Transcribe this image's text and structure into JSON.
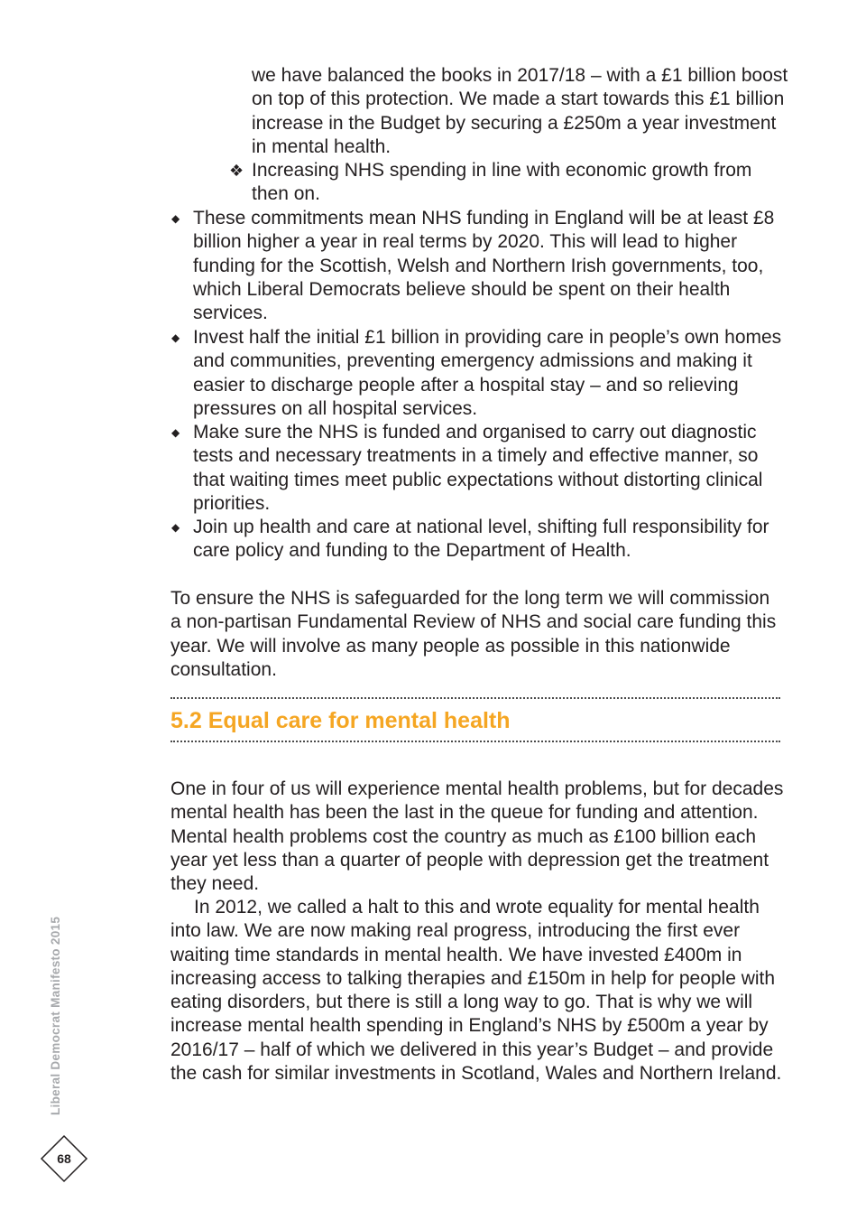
{
  "continuation": {
    "sub_items": [
      "we have balanced the books in 2017/18 – with a £1 billion boost on top of this protection. We made a start towards this £1 billion increase in the Budget by securing a £250m a year investment in mental health.",
      "Increasing NHS spending in line with economic growth from then on."
    ],
    "sub_bullet_glyph": "❖"
  },
  "bullets": {
    "glyph": "◆",
    "items": [
      "These commitments mean NHS funding in England will be at least £8 billion higher a year in real terms by 2020. This will lead to higher funding for the Scottish, Welsh and Northern Irish governments, too, which Liberal Democrats believe should be spent on their health services.",
      "Invest half the initial £1 billion in providing care in people’s own homes and communities, preventing emergency admissions and making it easier to discharge people after a hospital stay – and so relieving pressures on all hospital services.",
      "Make sure the NHS is funded and organised to carry out diagnostic tests and necessary treatments in a timely and effective manner, so that waiting times meet public expectations without distorting clinical priorities.",
      "Join up health and care at national level, shifting full responsibility for care policy and funding to the Department of Health."
    ]
  },
  "review_paragraph": "To ensure the NHS is safeguarded for the long term we will commission a non-partisan Fundamental Review of NHS and social care funding this year. We will involve as many people as possible in this nationwide consultation.",
  "section": {
    "heading": "5.2 Equal care for mental health",
    "heading_color": "#f5a623",
    "paragraphs": [
      "One in four of us will experience mental health problems, but for decades mental health has been the last in the queue for funding and attention. Mental health problems cost the country as much as £100 billion each year yet less than a quarter of people with depression get the treatment they need.",
      "In 2012, we called a halt to this and wrote equality for mental health into law. We are now making real progress, introducing the first ever waiting time standards in mental health. We have invested £400m in increasing access to talking therapies and £150m in help for people with eating disorders, but there is still a long way to go. That is why we will increase mental health spending in England’s NHS by £500m a year by 2016/17 – half of which we delivered in this year’s Budget – and provide the cash for similar investments in Scotland, Wales and Northern Ireland."
    ]
  },
  "footer": {
    "publication": "Liberal Democrat Manifesto 2015",
    "page_number": "68",
    "badge_icon": "diamond-outline-icon"
  }
}
